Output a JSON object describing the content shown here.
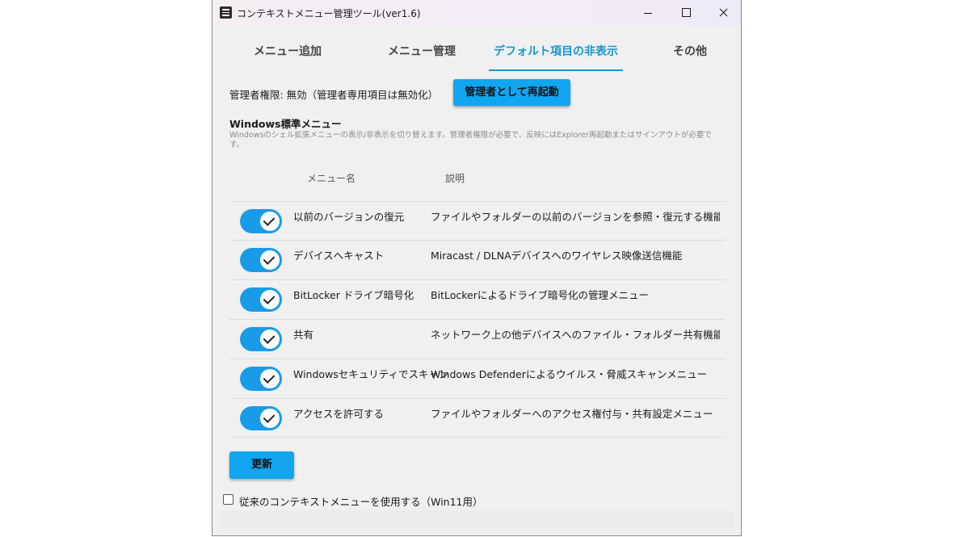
{
  "window": {
    "title": "コンテキストメニュー管理ツール(ver1.6)",
    "icon": "list-icon"
  },
  "tabs": [
    {
      "label": "メニュー追加",
      "active": false
    },
    {
      "label": "メニュー管理",
      "active": false
    },
    {
      "label": "デフォルト項目の非表示",
      "active": true
    },
    {
      "label": "その他",
      "active": false
    }
  ],
  "admin": {
    "status_label": "管理者権限: 無効（管理者専用項目は無効化）",
    "restart_label": "管理者として再起動"
  },
  "section": {
    "title": "Windows標準メニュー",
    "description": "Windowsのシェル拡張メニューの表示/非表示を切り替えます。管理者権限が必要で、反映にはExplorer再起動またはサインアウトが必要です。"
  },
  "table": {
    "headers": {
      "name": "メニュー名",
      "description": "説明"
    },
    "rows": [
      {
        "name": "以前のバージョンの復元",
        "description": "ファイルやフォルダーの以前のバージョンを参照・復元する機能（ポリュ",
        "enabled": true
      },
      {
        "name": "デバイスへキャスト",
        "description": "Miracast / DLNAデバイスへのワイヤレス映像送信機能",
        "enabled": true
      },
      {
        "name": "BitLocker ドライブ暗号化",
        "description": "BitLockerによるドライブ暗号化の管理メニュー",
        "enabled": true
      },
      {
        "name": "共有",
        "description": "ネットワーク上の他デバイスへのファイル・フォルダー共有機能",
        "enabled": true
      },
      {
        "name": "Windowsセキュリティでスキャン",
        "description": "Windows Defenderによるウイルス・脅威スキャンメニュー",
        "enabled": true
      },
      {
        "name": "アクセスを許可する",
        "description": "ファイルやフォルダーへのアクセス権付与・共有設定メニュー",
        "enabled": true
      }
    ]
  },
  "refresh_label": "更新",
  "legacy": {
    "label": "従来のコンテキストメニューを使用する（Win11用）",
    "checked": false
  },
  "colors": {
    "accent": "#1696d3",
    "button": "#12a5f0",
    "toggle_on": "#1a9be8"
  }
}
